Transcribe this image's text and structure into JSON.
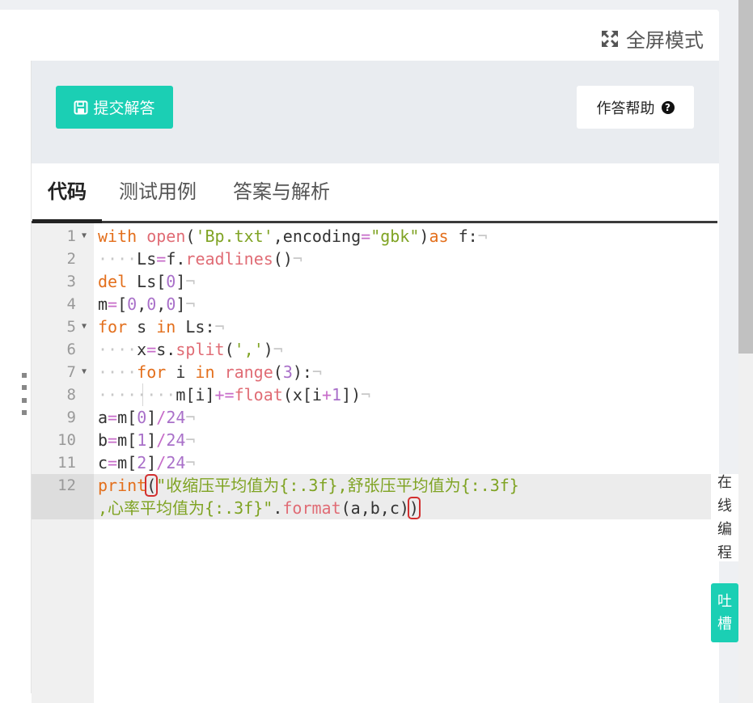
{
  "header": {
    "fullscreen_label": "全屏模式"
  },
  "actions": {
    "submit_label": "提交解答",
    "help_label": "作答帮助"
  },
  "tabs": [
    {
      "label": "代码",
      "active": true
    },
    {
      "label": "测试用例",
      "active": false
    },
    {
      "label": "答案与解析",
      "active": false
    }
  ],
  "editor": {
    "line_numbers": [
      "1",
      "2",
      "3",
      "4",
      "5",
      "6",
      "7",
      "8",
      "9",
      "10",
      "11",
      "12"
    ],
    "lines": [
      [
        [
          "kw",
          "with"
        ],
        [
          "t",
          " "
        ],
        [
          "fn",
          "open"
        ],
        [
          "t",
          "("
        ],
        [
          "str",
          "'Bp.txt'"
        ],
        [
          "t",
          ",encoding"
        ],
        [
          "op",
          "="
        ],
        [
          "str",
          "\"gbk\""
        ],
        [
          "t",
          ")"
        ],
        [
          "kw",
          "as"
        ],
        [
          "t",
          " f:"
        ]
      ],
      [
        [
          "ws",
          "····"
        ],
        [
          "t",
          "Ls"
        ],
        [
          "op",
          "="
        ],
        [
          "t",
          "f."
        ],
        [
          "fn",
          "readlines"
        ],
        [
          "t",
          "()"
        ]
      ],
      [
        [
          "kw",
          "del"
        ],
        [
          "t",
          " Ls["
        ],
        [
          "num",
          "0"
        ],
        [
          "t",
          "]"
        ]
      ],
      [
        [
          "t",
          "m"
        ],
        [
          "op",
          "="
        ],
        [
          "t",
          "["
        ],
        [
          "num",
          "0"
        ],
        [
          "t",
          ","
        ],
        [
          "num",
          "0"
        ],
        [
          "t",
          ","
        ],
        [
          "num",
          "0"
        ],
        [
          "t",
          "]"
        ]
      ],
      [
        [
          "kw",
          "for"
        ],
        [
          "t",
          " s "
        ],
        [
          "kw",
          "in"
        ],
        [
          "t",
          " Ls:"
        ]
      ],
      [
        [
          "ws",
          "····"
        ],
        [
          "t",
          "x"
        ],
        [
          "op",
          "="
        ],
        [
          "t",
          "s."
        ],
        [
          "fn",
          "split"
        ],
        [
          "t",
          "("
        ],
        [
          "str",
          "','"
        ],
        [
          "t",
          ")"
        ]
      ],
      [
        [
          "ws",
          "····"
        ],
        [
          "kw",
          "for"
        ],
        [
          "t",
          " i "
        ],
        [
          "kw",
          "in"
        ],
        [
          "t",
          " "
        ],
        [
          "fn",
          "range"
        ],
        [
          "t",
          "("
        ],
        [
          "num",
          "3"
        ],
        [
          "t",
          "):"
        ]
      ],
      [
        [
          "ws",
          "········"
        ],
        [
          "t",
          "m[i]"
        ],
        [
          "op",
          "+="
        ],
        [
          "fn",
          "float"
        ],
        [
          "t",
          "(x[i"
        ],
        [
          "op",
          "+"
        ],
        [
          "num",
          "1"
        ],
        [
          "t",
          "])"
        ]
      ],
      [
        [
          "t",
          "a"
        ],
        [
          "op",
          "="
        ],
        [
          "t",
          "m["
        ],
        [
          "num",
          "0"
        ],
        [
          "t",
          "]"
        ],
        [
          "op",
          "/"
        ],
        [
          "num",
          "24"
        ]
      ],
      [
        [
          "t",
          "b"
        ],
        [
          "op",
          "="
        ],
        [
          "t",
          "m["
        ],
        [
          "num",
          "1"
        ],
        [
          "t",
          "]"
        ],
        [
          "op",
          "/"
        ],
        [
          "num",
          "24"
        ]
      ],
      [
        [
          "t",
          "c"
        ],
        [
          "op",
          "="
        ],
        [
          "t",
          "m["
        ],
        [
          "num",
          "2"
        ],
        [
          "t",
          "]"
        ],
        [
          "op",
          "/"
        ],
        [
          "num",
          "24"
        ]
      ],
      [
        [
          "fnb",
          "print"
        ],
        [
          "br",
          "("
        ],
        [
          "str",
          "\"收缩压平均值为{:.3f},舒张压平均值为{:.3f}"
        ]
      ],
      [
        [
          "str",
          ",心率平均值为{:.3f}\""
        ],
        [
          "t",
          "."
        ],
        [
          "fn",
          "format"
        ],
        [
          "t",
          "(a,b,c)"
        ],
        [
          "br",
          ")"
        ]
      ]
    ]
  },
  "side": {
    "online_label": [
      "在",
      "线",
      "编",
      "程"
    ],
    "feedback_label": [
      "吐",
      "槽"
    ]
  }
}
